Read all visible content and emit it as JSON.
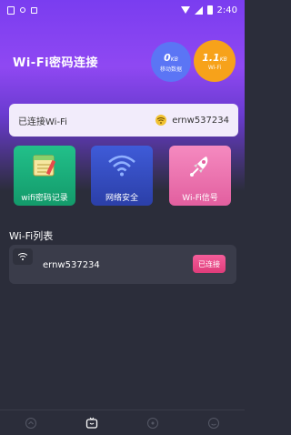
{
  "status_bar": {
    "time": "2:40"
  },
  "header": {
    "app_title": "Wi-Fi密码连接",
    "stats": [
      {
        "value": "0",
        "unit": "KB",
        "label": "移动数据",
        "color": "#5b75f5"
      },
      {
        "value": "1.1",
        "unit": "KB",
        "label": "Wi-Fi",
        "color": "#f7a21a"
      }
    ]
  },
  "connected": {
    "label": "已连接Wi-Fi",
    "ssid": "ernw537234"
  },
  "tiles": [
    {
      "label": "wifi密码记录",
      "icon": "notebook-icon"
    },
    {
      "label": "网络安全",
      "icon": "wifi-signal-icon"
    },
    {
      "label": "Wi-Fi信号",
      "icon": "rocket-icon"
    }
  ],
  "wifi_list": {
    "title": "Wi-Fi列表",
    "items": [
      {
        "ssid": "ernw537234",
        "button": "已连接"
      }
    ]
  },
  "bottom_nav": [
    "home-icon",
    "tv-icon",
    "target-icon",
    "smile-icon"
  ]
}
